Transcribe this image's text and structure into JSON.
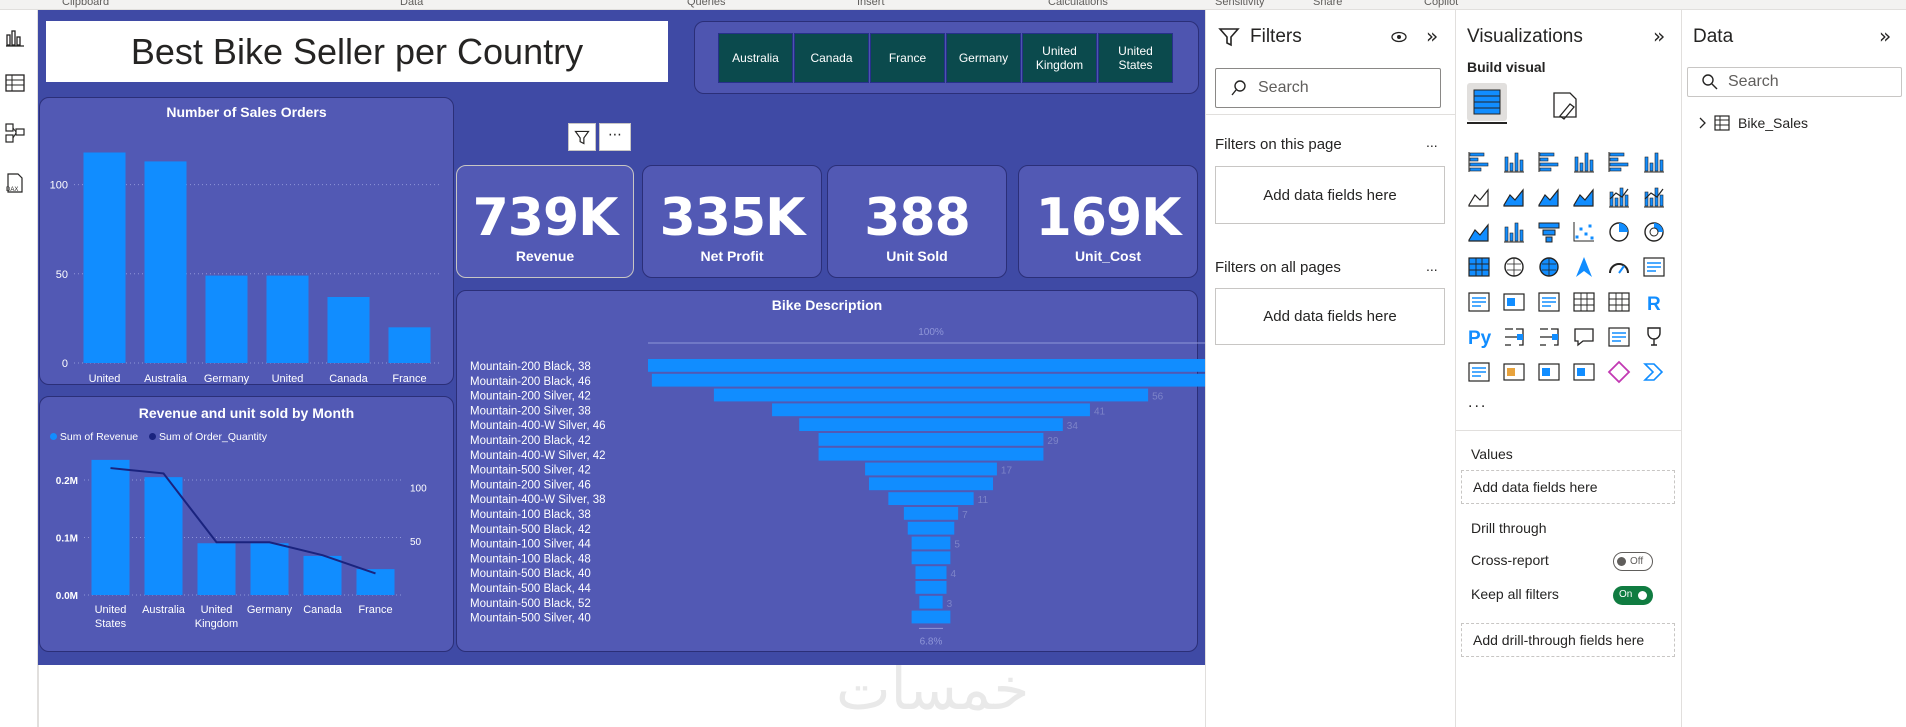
{
  "ribbon": {
    "groups": [
      "Clipboard",
      "Data",
      "Queries",
      "Insert",
      "Calculations",
      "Sensitivity",
      "Share",
      "Copilot"
    ]
  },
  "report": {
    "title": "Best Bike Seller per Country",
    "slicer": [
      "Australia",
      "Canada",
      "France",
      "Germany",
      "United Kingdom",
      "United States"
    ],
    "kpis": [
      {
        "value": "739K",
        "label": "Revenue"
      },
      {
        "value": "335K",
        "label": "Net Profit"
      },
      {
        "value": "388",
        "label": "Unit Sold"
      },
      {
        "value": "169K",
        "label": "Unit_Cost"
      }
    ],
    "watermark": "خمسات"
  },
  "chart_data": [
    {
      "type": "bar",
      "title": "Number of Sales Orders",
      "categories": [
        "United States",
        "Australia",
        "Germany",
        "United Kingdom",
        "Canada",
        "France"
      ],
      "values": [
        118,
        113,
        49,
        49,
        37,
        20
      ],
      "yticks": [
        "100",
        "50",
        "0"
      ],
      "ylim": [
        0,
        125
      ]
    },
    {
      "type": "bar",
      "title": "Revenue and unit sold by Month",
      "legend": [
        "Sum of Revenue",
        "Sum of Order_Quantity"
      ],
      "categories": [
        "United States",
        "Australia",
        "United Kingdom",
        "Germany",
        "Canada",
        "France"
      ],
      "series": [
        {
          "name": "Sum of Revenue",
          "values": [
            0.235,
            0.205,
            0.09,
            0.09,
            0.068,
            0.045
          ]
        },
        {
          "name": "Sum of Order_Quantity",
          "values": [
            118,
            113,
            49,
            49,
            37,
            20
          ]
        }
      ],
      "yticks_left": [
        "0.2M",
        "0.1M",
        "0.0M"
      ],
      "yticks_right": [
        "100",
        "50"
      ]
    },
    {
      "type": "funnel",
      "title": "Bike Description",
      "top_label": "100%",
      "bottom_label": "6.8%",
      "categories": [
        "Mountain-200 Black, 38",
        "Mountain-200 Black, 46",
        "Mountain-200 Silver, 42",
        "Mountain-200 Silver, 38",
        "Mountain-400-W Silver, 46",
        "Mountain-200 Black, 42",
        "Mountain-400-W Silver, 42",
        "Mountain-500 Silver, 42",
        "Mountain-200 Silver, 46",
        "Mountain-400-W Silver, 38",
        "Mountain-100 Black, 38",
        "Mountain-500 Black, 42",
        "Mountain-100 Silver, 44",
        "Mountain-100 Black, 48",
        "Mountain-500 Black, 40",
        "Mountain-500 Black, 44",
        "Mountain-500 Black, 52",
        "Mountain-500 Silver, 40"
      ],
      "values": [
        73,
        72,
        56,
        41,
        34,
        29,
        29,
        17,
        16,
        11,
        7,
        6,
        5,
        5,
        4,
        4,
        3,
        5
      ],
      "value_labels": [
        "",
        "",
        "56",
        "41",
        "34",
        "29",
        "",
        "17",
        "",
        "11",
        "7",
        "",
        "5",
        "",
        "4",
        "",
        "3",
        ""
      ]
    }
  ],
  "filters": {
    "title": "Filters",
    "search": "Search",
    "on_page": "Filters on this page",
    "all_pages": "Filters on all pages",
    "add_fields": "Add data fields here",
    "more": "..."
  },
  "visualizations": {
    "title": "Visualizations",
    "build": "Build visual",
    "more": "...",
    "values": "Values",
    "add_fields": "Add data fields here",
    "drill": "Drill through",
    "cross": "Cross-report",
    "cross_state": "Off",
    "keep": "Keep all filters",
    "keep_state": "On",
    "add_drill": "Add drill-through fields here",
    "py": "Py",
    "r": "R"
  },
  "data_pane": {
    "title": "Data",
    "search": "Search",
    "table": "Bike_Sales"
  },
  "colors": {
    "canvas": "#3f4aa5",
    "panel": "#5259b4",
    "bar": "#118dff",
    "slicer": "#0b4a4d",
    "line": "#1a237e",
    "toggle_on": "#107c41"
  }
}
